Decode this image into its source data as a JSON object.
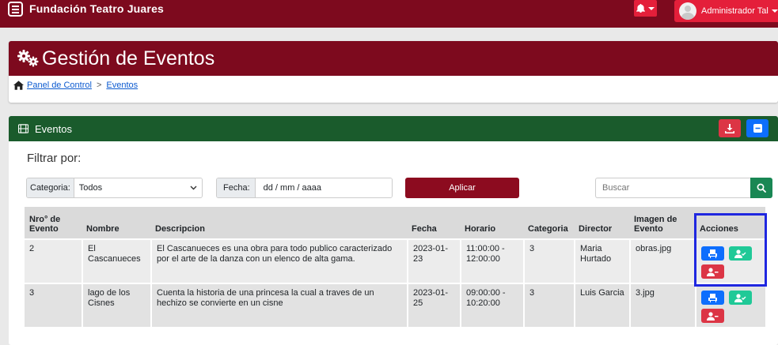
{
  "topbar": {
    "brand": "Fundación Teatro Juares",
    "user_name": "Administrador Tal",
    "icons": [
      "menu-icon",
      "bell-icon",
      "user-avatar"
    ],
    "color": "#7d0a1e"
  },
  "page": {
    "title": "Gestión de Eventos",
    "breadcrumb": [
      "Panel de Control",
      "Eventos"
    ],
    "breadcrumb_sep": ">"
  },
  "events": {
    "header": "Eventos",
    "header_color": "#1a5b2c",
    "filter": {
      "title": "Filtrar por:",
      "category_label": "Categoria:",
      "category_value": "Todos",
      "date_label": "Fecha:",
      "date_placeholder": "dd / mm / aaaa",
      "apply_label": "Aplicar",
      "search_placeholder": "Buscar"
    },
    "table": {
      "headers": [
        "Nro° de Evento",
        "Nombre",
        "Descripcion",
        "Fecha",
        "Horario",
        "Categoria",
        "Director",
        "Imagen de Evento",
        "Acciones"
      ],
      "rows": [
        {
          "nro": "2",
          "nombre": "El Cascanueces",
          "descripcion": "El Cascanueces es una obra para todo publico caracterizado por el arte de la danza con un elenco de alta gama.",
          "fecha": "2023-01-23",
          "horario": "11:00:00 - 12:00:00",
          "categoria": "3",
          "director": "Maria Hurtado",
          "imagen": "obras.jpg"
        },
        {
          "nro": "3",
          "nombre": "lago de los Cisnes",
          "descripcion": "Cuenta la historia de una princesa la cual a traves de un hechizo se convierte en un cisne",
          "fecha": "2023-01-25",
          "horario": "09:00:00 - 10:20:00",
          "categoria": "3",
          "director": "Luis Garcia",
          "imagen": "3.jpg"
        }
      ],
      "action_icons": [
        "seat-icon",
        "user-check-icon",
        "user-remove-icon"
      ]
    }
  }
}
